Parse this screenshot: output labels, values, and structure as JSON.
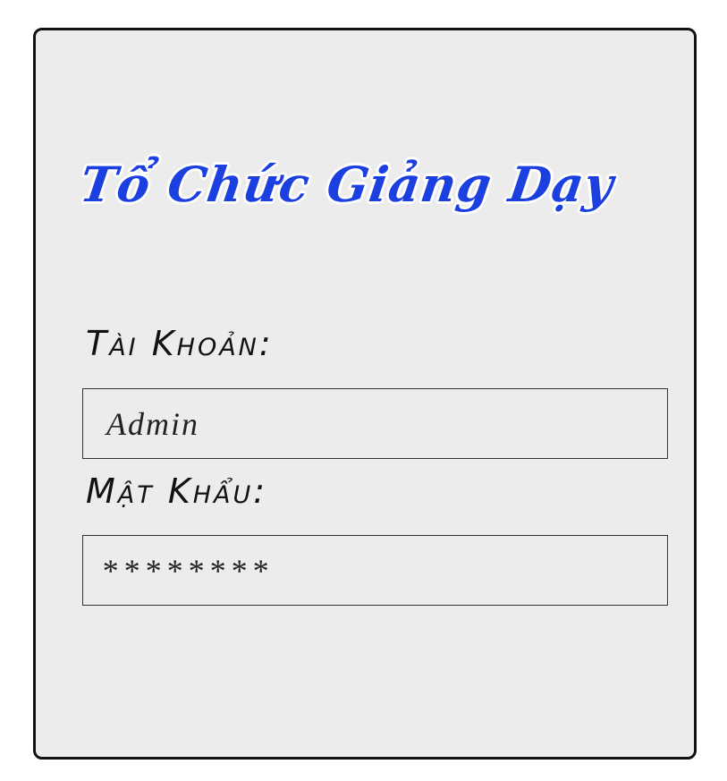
{
  "login": {
    "title": "Tổ Chức Giảng Dạy",
    "username_label": "Tài Khoản:",
    "username_value": "Admin",
    "password_label": "Mật Khẩu:",
    "password_value": "********"
  },
  "colors": {
    "title": "#1c3fe0",
    "panel_background": "#ececec",
    "panel_border": "#111111"
  }
}
